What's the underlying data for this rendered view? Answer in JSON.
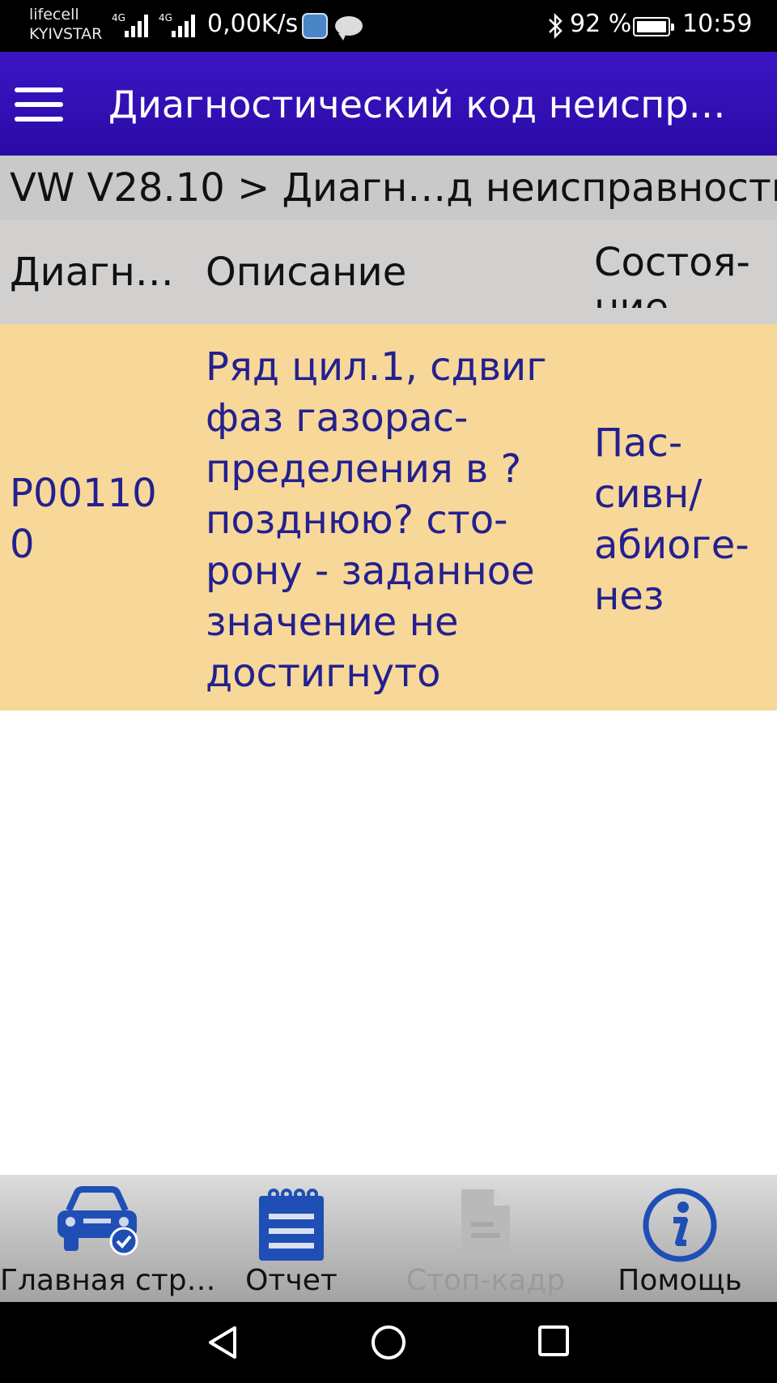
{
  "status_bar": {
    "carrier_1": "lifecell",
    "carrier_2": "KYIVSTAR",
    "network_1": "4G",
    "network_2": "4G",
    "net_speed": "0,00K/s",
    "bluetooth_icon": "bluetooth-icon",
    "battery_percent": "92 %",
    "time": "10:59"
  },
  "app_bar": {
    "title": "Диагностический код неиспр…"
  },
  "breadcrumb": "VW V28.10 > Диагн…д неисправности",
  "table": {
    "headers": [
      "Диагн…",
      "Описание",
      "Состоя-ние"
    ],
    "rows": [
      {
        "code": "P00110 0",
        "description": "Ряд цил.1, сдвиг фаз газорас-пределения в ?позднюю? сто-рону - заданное значение не достигнуто",
        "state": "Пас-сивн/ абиоге-нез"
      }
    ],
    "row_highlight_color": "#f7d899",
    "text_color": "#24208f"
  },
  "toolbar": {
    "items": [
      {
        "label": "Главная стр…",
        "icon": "car-icon",
        "enabled": true
      },
      {
        "label": "Отчет",
        "icon": "report-icon",
        "enabled": true
      },
      {
        "label": "Стоп-кадр",
        "icon": "freeze-frame-icon",
        "enabled": false
      },
      {
        "label": "Помощь",
        "icon": "info-icon",
        "enabled": true
      }
    ]
  },
  "nav_bar": {
    "back": "back-icon",
    "home": "home-icon",
    "recents": "recents-icon"
  },
  "colors": {
    "app_bar": "#2a0aa6",
    "accent_icon": "#1f4fb5"
  }
}
